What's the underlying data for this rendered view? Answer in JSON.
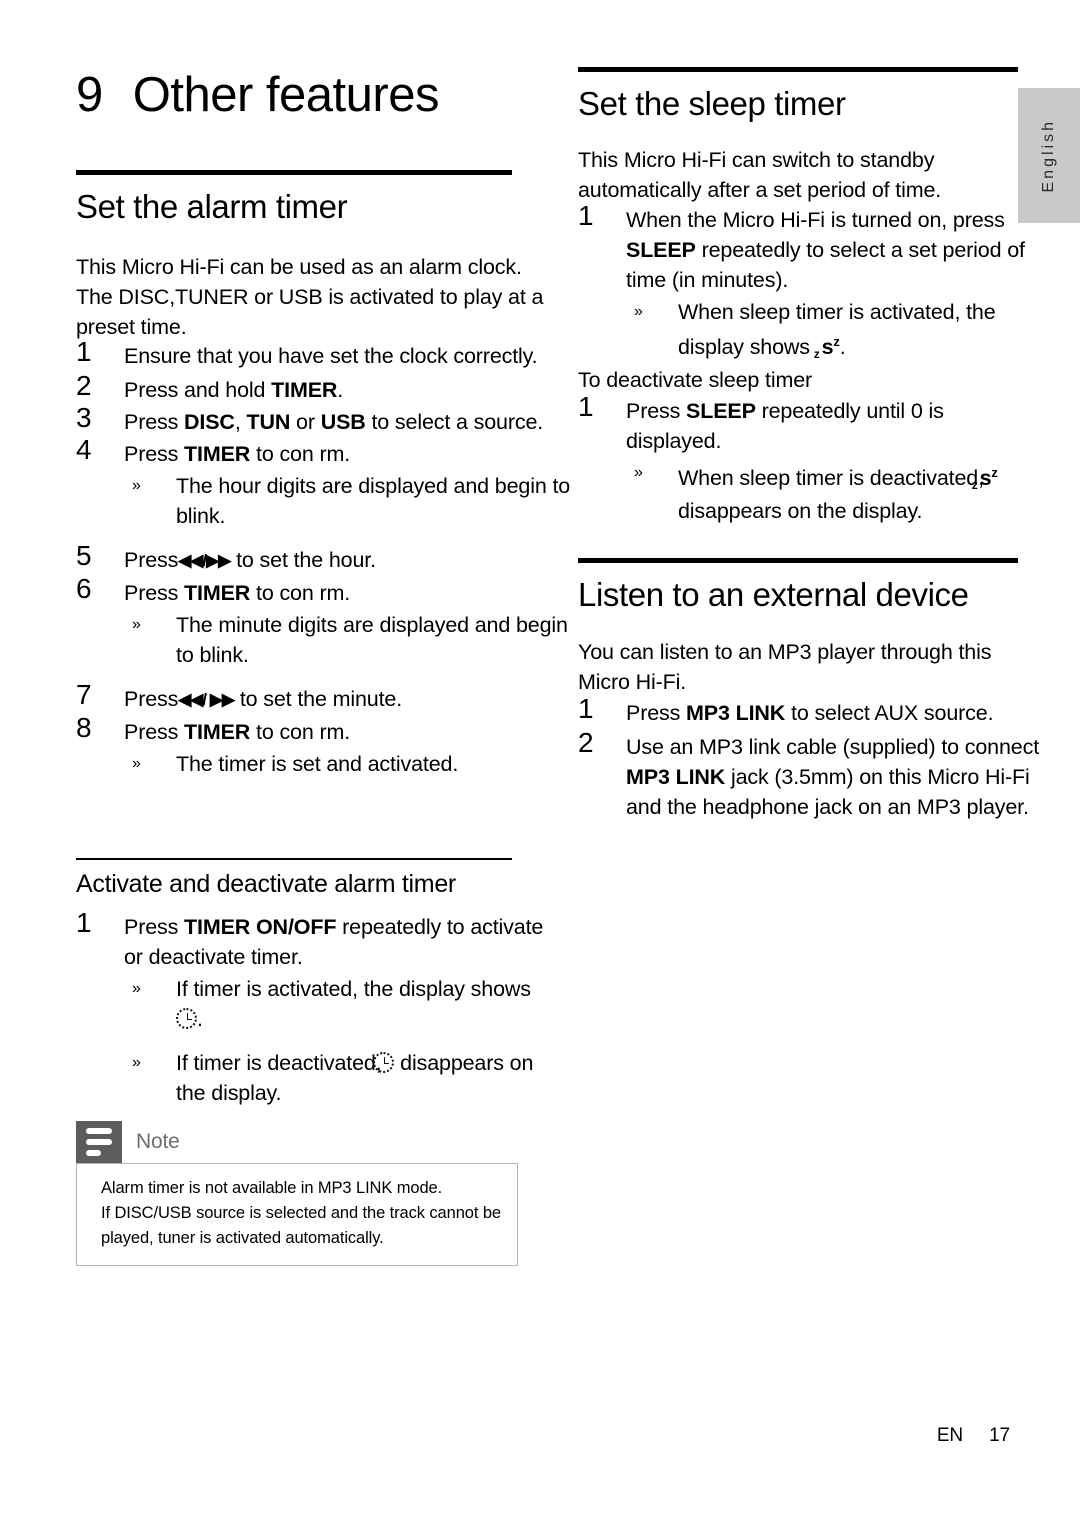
{
  "language_tab": {
    "label": "English"
  },
  "footer": {
    "locale": "EN",
    "page_number": "17"
  },
  "chapter": {
    "number": "9",
    "title": "Other features"
  },
  "left_column": {
    "alarm": {
      "heading": "Set the alarm timer",
      "intro": "This Micro Hi-Fi can be used as an alarm clock. The DISC,TUNER or USB is activated to play at a preset time.",
      "steps": [
        {
          "num": "1",
          "parts": [
            {
              "t": "Ensure that you have set the clock correctly.",
              "bold": false
            }
          ]
        },
        {
          "num": "2",
          "parts": [
            {
              "t": "Press and hold ",
              "bold": false
            },
            {
              "t": "TIMER",
              "bold": true
            },
            {
              "t": ".",
              "bold": false
            }
          ]
        },
        {
          "num": "3",
          "parts": [
            {
              "t": "Press ",
              "bold": false
            },
            {
              "t": "DISC",
              "bold": true
            },
            {
              "t": ", ",
              "bold": false
            },
            {
              "t": "TUN",
              "bold": true
            },
            {
              "t": " or ",
              "bold": false
            },
            {
              "t": "USB",
              "bold": true
            },
            {
              "t": " to select a source.",
              "bold": false
            }
          ]
        },
        {
          "num": "4",
          "parts": [
            {
              "t": "Press ",
              "bold": false
            },
            {
              "t": "TIMER",
              "bold": true
            },
            {
              "t": " to con rm.",
              "bold": false
            }
          ],
          "subs": [
            "The hour digits are displayed and begin to blink."
          ]
        },
        {
          "num": "5",
          "parts": [
            {
              "t": "Press ",
              "bold": false
            },
            {
              "t": "GLYPH_PREV_NEXT",
              "bold": true
            },
            {
              "t": " to set the hour.",
              "bold": false
            }
          ]
        },
        {
          "num": "6",
          "parts": [
            {
              "t": "Press ",
              "bold": false
            },
            {
              "t": "TIMER",
              "bold": true
            },
            {
              "t": " to con rm.",
              "bold": false
            }
          ],
          "subs": [
            "The minute digits are displayed and begin to blink."
          ]
        },
        {
          "num": "7",
          "parts": [
            {
              "t": "Press ",
              "bold": false
            },
            {
              "t": "GLYPH_PREV_NEXT2",
              "bold": true
            },
            {
              "t": " to set the minute.",
              "bold": false
            }
          ]
        },
        {
          "num": "8",
          "parts": [
            {
              "t": "Press ",
              "bold": false
            },
            {
              "t": "TIMER",
              "bold": true
            },
            {
              "t": " to con rm.",
              "bold": false
            }
          ],
          "subs": [
            "The timer is set and activated."
          ]
        }
      ]
    },
    "activate_alarm": {
      "heading": "Activate and deactivate alarm timer",
      "step_num": "1",
      "step_prefix": "Press ",
      "step_bold": "TIMER ON/OFF",
      "step_suffix": " repeatedly to activate or deactivate timer.",
      "sub_activated_pre": "If timer is activated, the display shows ",
      "sub_activated_post": ".",
      "sub_deactivated_pre": "If timer is deactivated, ",
      "sub_deactivated_post": " disappears on the display."
    },
    "note": {
      "title": "Note",
      "lines": [
        "Alarm timer is not available in MP3 LINK mode.",
        "If DISC/USB source is selected and the track cannot be",
        "played, tuner is activated automatically."
      ]
    }
  },
  "right_column": {
    "sleep": {
      "heading": "Set the sleep timer",
      "intro": "This Micro Hi-Fi can switch to standby automatically after a set period of time.",
      "step_num": "1",
      "step_line1_pre": "When the Micro Hi-Fi is turned on, press ",
      "step_line1_bold": "SLEEP",
      "step_line1_post": " repeatedly to select a set period of time (in minutes).",
      "sub_activated_pre": "When sleep timer is activated, the display shows ",
      "sub_activated_post": ".",
      "deactivate_heading": "To deactivate sleep timer",
      "deactivate_num": "1",
      "deactivate_pre": "Press ",
      "deactivate_bold": "SLEEP",
      "deactivate_post": " repeatedly until  0  is displayed.",
      "deactivate_sub_pre": "When sleep timer is deactivated, ",
      "deactivate_sub_post": " disappears on the display."
    },
    "external": {
      "heading": "Listen to an external device",
      "intro": "You can listen to an MP3 player through this Micro Hi-Fi.",
      "steps": [
        {
          "num": "1",
          "pre": "Press ",
          "bold": "MP3 LINK",
          "post": " to select AUX source."
        },
        {
          "num": "2",
          "pre": "Use an MP3 link cable (supplied) to connect ",
          "bold": "MP3 LINK",
          "post": " jack (3.5mm) on this Micro Hi-Fi and the headphone jack on an MP3 player."
        }
      ]
    }
  },
  "glyphs": {
    "prev": "◀◀",
    "next": "▶▶",
    "slash": "/",
    "sub_bullet": "»",
    "sleep_s": "s",
    "sleep_z": "z",
    "sleep_zsup": "z"
  }
}
